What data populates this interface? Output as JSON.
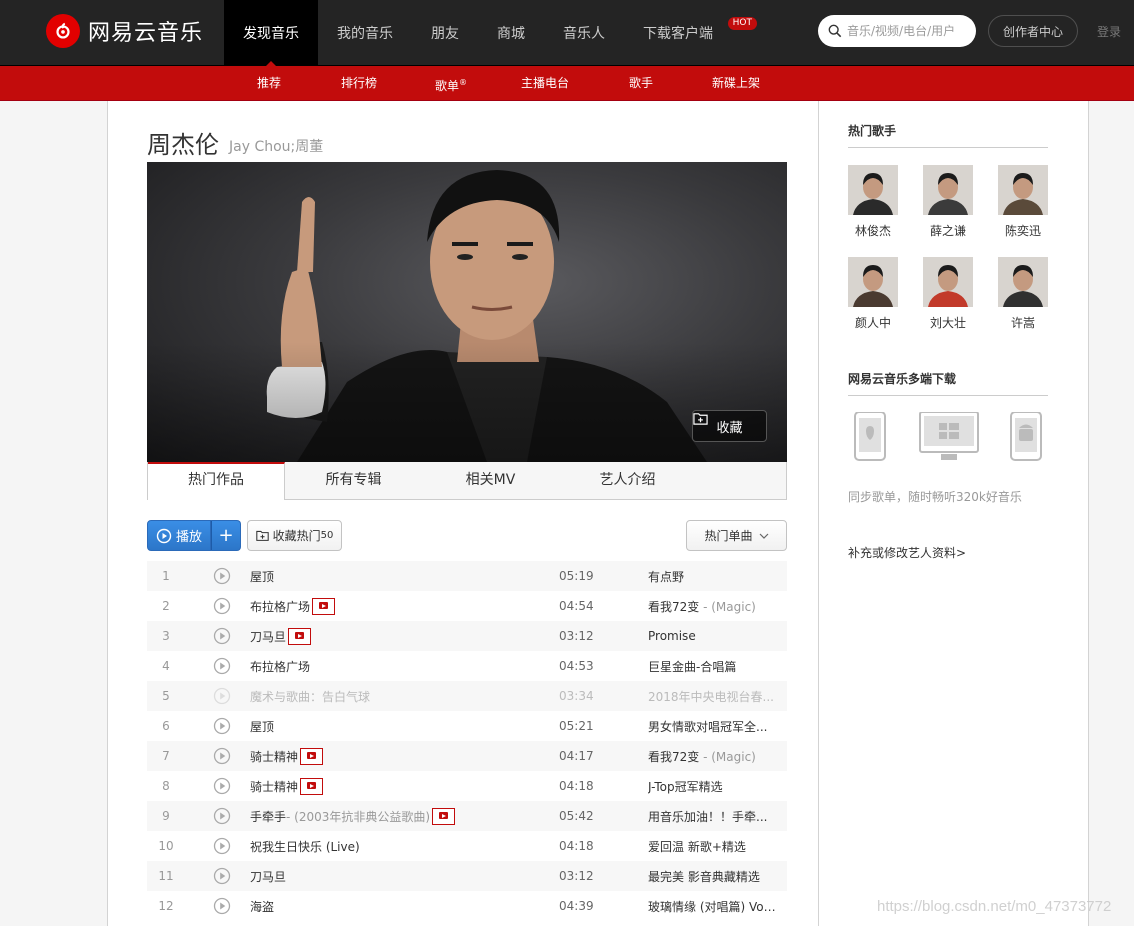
{
  "header": {
    "logo_text": "网易云音乐",
    "nav": [
      {
        "label": "发现音乐",
        "active": true
      },
      {
        "label": "我的音乐"
      },
      {
        "label": "朋友"
      },
      {
        "label": "商城"
      },
      {
        "label": "音乐人"
      },
      {
        "label": "下载客户端",
        "badge": "HOT"
      }
    ],
    "search_placeholder": "音乐/视频/电台/用户",
    "creator_label": "创作者中心",
    "login_label": "登录"
  },
  "subnav": [
    "推荐",
    "排行榜",
    "歌单",
    "主播电台",
    "歌手",
    "新碟上架"
  ],
  "subnav_sup": "®",
  "artist": {
    "name": "周杰伦",
    "alias": "Jay Chou;周董",
    "collect_label": "收藏"
  },
  "tabs": [
    "热门作品",
    "所有专辑",
    "相关MV",
    "艺人介绍"
  ],
  "actions": {
    "play_label": "播放",
    "add_label": "+",
    "collect_hot_label": "收藏热门",
    "collect_hot_count": "50",
    "hot_select_label": "热门单曲"
  },
  "songs": [
    {
      "num": "1",
      "title": "屋顶",
      "sub": "",
      "mv": false,
      "duration": "05:19",
      "album": "有点野",
      "album_sub": "",
      "disabled": false
    },
    {
      "num": "2",
      "title": "布拉格广场",
      "sub": "",
      "mv": true,
      "duration": "04:54",
      "album": "看我72变",
      "album_sub": " - (Magic)",
      "disabled": false
    },
    {
      "num": "3",
      "title": "刀马旦",
      "sub": "",
      "mv": true,
      "duration": "03:12",
      "album": "Promise",
      "album_sub": "",
      "disabled": false
    },
    {
      "num": "4",
      "title": "布拉格广场",
      "sub": "",
      "mv": false,
      "duration": "04:53",
      "album": "巨星金曲-合唱篇",
      "album_sub": "",
      "disabled": false
    },
    {
      "num": "5",
      "title": "魔术与歌曲：告白气球",
      "sub": "",
      "mv": false,
      "duration": "03:34",
      "album": "2018年中央电视台春...",
      "album_sub": "",
      "disabled": true
    },
    {
      "num": "6",
      "title": "屋顶",
      "sub": "",
      "mv": false,
      "duration": "05:21",
      "album": "男女情歌对唱冠军全...",
      "album_sub": "",
      "disabled": false
    },
    {
      "num": "7",
      "title": "骑士精神",
      "sub": "",
      "mv": true,
      "duration": "04:17",
      "album": "看我72变",
      "album_sub": " - (Magic)",
      "disabled": false
    },
    {
      "num": "8",
      "title": "骑士精神",
      "sub": "",
      "mv": true,
      "duration": "04:18",
      "album": "J-Top冠军精选",
      "album_sub": "",
      "disabled": false
    },
    {
      "num": "9",
      "title": "手牵手",
      "sub": " - (2003年抗非典公益歌曲)",
      "mv": true,
      "duration": "05:42",
      "album": "用音乐加油！！手牵...",
      "album_sub": "",
      "disabled": false
    },
    {
      "num": "10",
      "title": "祝我生日快乐 (Live)",
      "sub": "",
      "mv": false,
      "duration": "04:18",
      "album": "爱回温 新歌+精选",
      "album_sub": "",
      "disabled": false
    },
    {
      "num": "11",
      "title": "刀马旦",
      "sub": "",
      "mv": false,
      "duration": "03:12",
      "album": "最完美 影音典藏精选",
      "album_sub": "",
      "disabled": false
    },
    {
      "num": "12",
      "title": "海盗",
      "sub": "",
      "mv": false,
      "duration": "04:39",
      "album": "玻璃情缘 (对唱篇) Vol...",
      "album_sub": "",
      "disabled": false
    }
  ],
  "sidebar": {
    "hot_singers_title": "热门歌手",
    "singers": [
      {
        "name": "林俊杰",
        "color": "#2a2a2a"
      },
      {
        "name": "薛之谦",
        "color": "#3b3b3b"
      },
      {
        "name": "陈奕迅",
        "color": "#5a4a3a"
      },
      {
        "name": "颜人中",
        "color": "#4a3a30"
      },
      {
        "name": "刘大壮",
        "color": "#c23a2a"
      },
      {
        "name": "许嵩",
        "color": "#303030"
      }
    ],
    "download_title": "网易云音乐多端下载",
    "sync_text": "同步歌单，随时畅听320k好音乐",
    "edit_link": "补充或修改艺人资料>"
  },
  "watermark": "https://blog.csdn.net/m0_47373772",
  "colors": {
    "brand_red": "#c20c0c",
    "topbar": "#242424",
    "play_blue": "#2c76c9"
  }
}
